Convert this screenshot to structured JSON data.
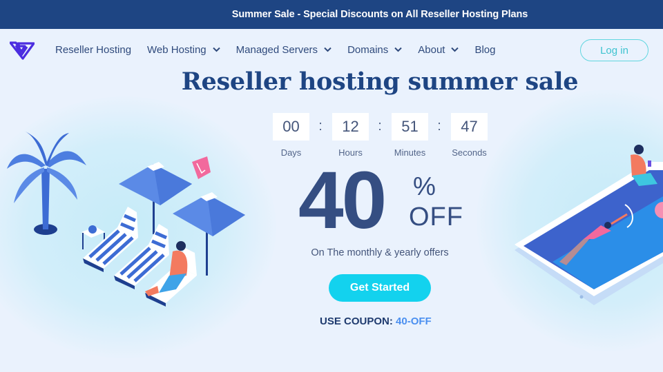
{
  "announcement": "Summer Sale - Special Discounts on All Reseller Hosting Plans",
  "nav": {
    "logo": "brand-logo",
    "items": [
      {
        "label": "Reseller Hosting",
        "dropdown": false
      },
      {
        "label": "Web Hosting",
        "dropdown": true
      },
      {
        "label": "Managed Servers",
        "dropdown": true
      },
      {
        "label": "Domains",
        "dropdown": true
      },
      {
        "label": "About",
        "dropdown": true
      },
      {
        "label": "Blog",
        "dropdown": false
      }
    ],
    "login_label": "Log in"
  },
  "hero": {
    "title": "Reseller hosting summer sale",
    "countdown": [
      {
        "value": "00",
        "label": "Days"
      },
      {
        "value": "12",
        "label": "Hours"
      },
      {
        "value": "51",
        "label": "Minutes"
      },
      {
        "value": "47",
        "label": "Seconds"
      }
    ],
    "separator": ":",
    "discount_number": "40",
    "discount_percent": "%",
    "discount_off": "OFF",
    "subtitle": "On The monthly & yearly offers",
    "cta_label": "Get Started",
    "coupon_label": "USE COUPON:",
    "coupon_code": "40-OFF"
  },
  "colors": {
    "topbar": "#1e4583",
    "accent_cyan": "#13d2ee",
    "login_border": "#5fd6df",
    "coupon_code": "#4a8ff0",
    "heading": "#1e4583"
  }
}
